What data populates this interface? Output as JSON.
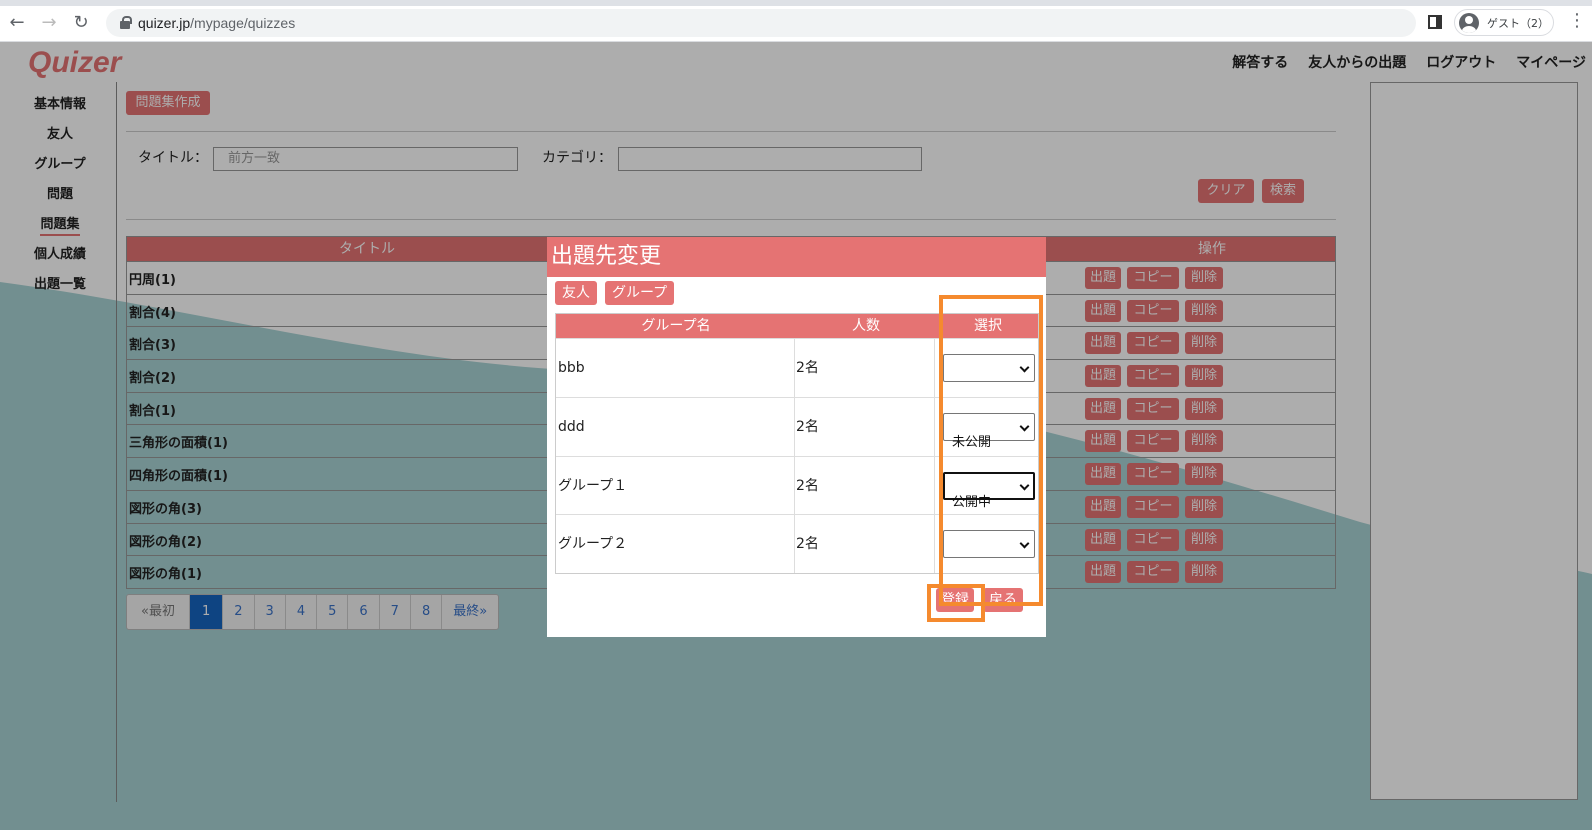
{
  "browser": {
    "url_host": "quizer.jp",
    "url_path": "/mypage/quizzes",
    "profile_name": "ゲスト（2）"
  },
  "app": {
    "logo": "Quizer",
    "topnav": [
      "解答する",
      "友人からの出題",
      "ログアウト",
      "マイページ"
    ],
    "sidebar": [
      {
        "label": "基本情報",
        "active": false
      },
      {
        "label": "友人",
        "active": false
      },
      {
        "label": "グループ",
        "active": false
      },
      {
        "label": "問題",
        "active": false
      },
      {
        "label": "問題集",
        "active": true
      },
      {
        "label": "個人成績",
        "active": false
      },
      {
        "label": "出題一覧",
        "active": false
      }
    ],
    "create_button": "問題集作成",
    "search": {
      "title_label": "タイトル：",
      "title_placeholder": "前方一致",
      "category_label": "カテゴリ：",
      "category_value": "",
      "clear_button": "クリア",
      "search_button": "検索"
    },
    "table": {
      "headers": {
        "title": "タイトル",
        "operations": "操作"
      },
      "op_labels": {
        "assign": "出題",
        "copy": "コピー",
        "delete": "削除"
      },
      "rows": [
        "円周(1)",
        "割合(4)",
        "割合(3)",
        "割合(2)",
        "割合(1)",
        "三角形の面積(1)",
        "四角形の面積(1)",
        "図形の角(3)",
        "図形の角(2)",
        "図形の角(1)"
      ]
    },
    "pager": {
      "first": "«最初",
      "pages": [
        "1",
        "2",
        "3",
        "4",
        "5",
        "6",
        "7",
        "8"
      ],
      "current": "1",
      "last": "最終»"
    }
  },
  "modal": {
    "title": "出題先変更",
    "tabs": [
      "友人",
      "グループ"
    ],
    "headers": {
      "name": "グループ名",
      "count": "人数",
      "select": "選択"
    },
    "rows": [
      {
        "name": "bbb",
        "count": "2名",
        "status": ""
      },
      {
        "name": "ddd",
        "count": "2名",
        "status": "未公開"
      },
      {
        "name": "グループ１",
        "count": "2名",
        "status": "公開中"
      },
      {
        "name": "グループ２",
        "count": "2名",
        "status": ""
      }
    ],
    "register_button": "登録",
    "back_button": "戻る"
  },
  "colors": {
    "accent": "#e57373",
    "teal_wave": "#a9d3d4",
    "highlight": "#f58a2e",
    "pager_active": "#1565c0"
  }
}
